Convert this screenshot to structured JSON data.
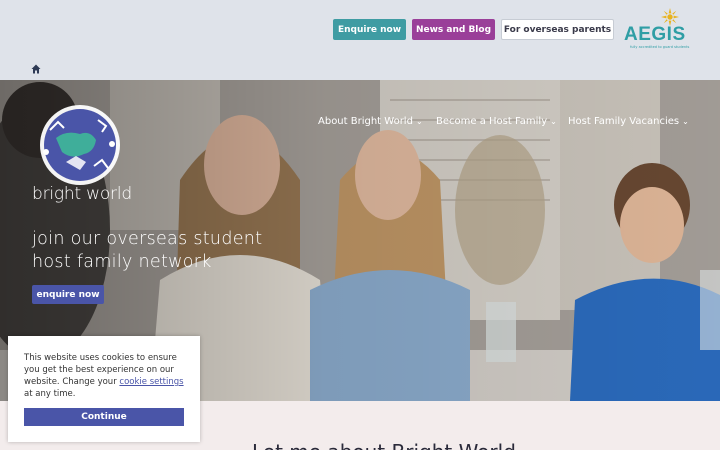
{
  "header": {
    "buttons": {
      "enquire": "Enquire now",
      "news": "News and Blog",
      "overseas": "For overseas parents"
    },
    "aegis": {
      "name": "AEGIS",
      "tagline": "fully accredited to guard students"
    },
    "home_icon": "home-icon"
  },
  "hero": {
    "logo_text": "bright world",
    "nav": [
      {
        "label": "About Bright World"
      },
      {
        "label": "Become a Host Family"
      },
      {
        "label": "Host Family Vacancies"
      }
    ],
    "headline_line1": "join our overseas student",
    "headline_line2": "host family network",
    "cta": "enquire now"
  },
  "cookie": {
    "text_before": "This website uses cookies to ensure you get the best experience on our website. Change your ",
    "link": "cookie settings",
    "text_after": " at any time.",
    "button": "Continue"
  },
  "section_title": "Let me about Bright World",
  "colors": {
    "teal": "#3f9ca3",
    "purple": "#9a3f99",
    "brand_blue": "#4a55a8",
    "topbar": "#dfe3ea"
  }
}
